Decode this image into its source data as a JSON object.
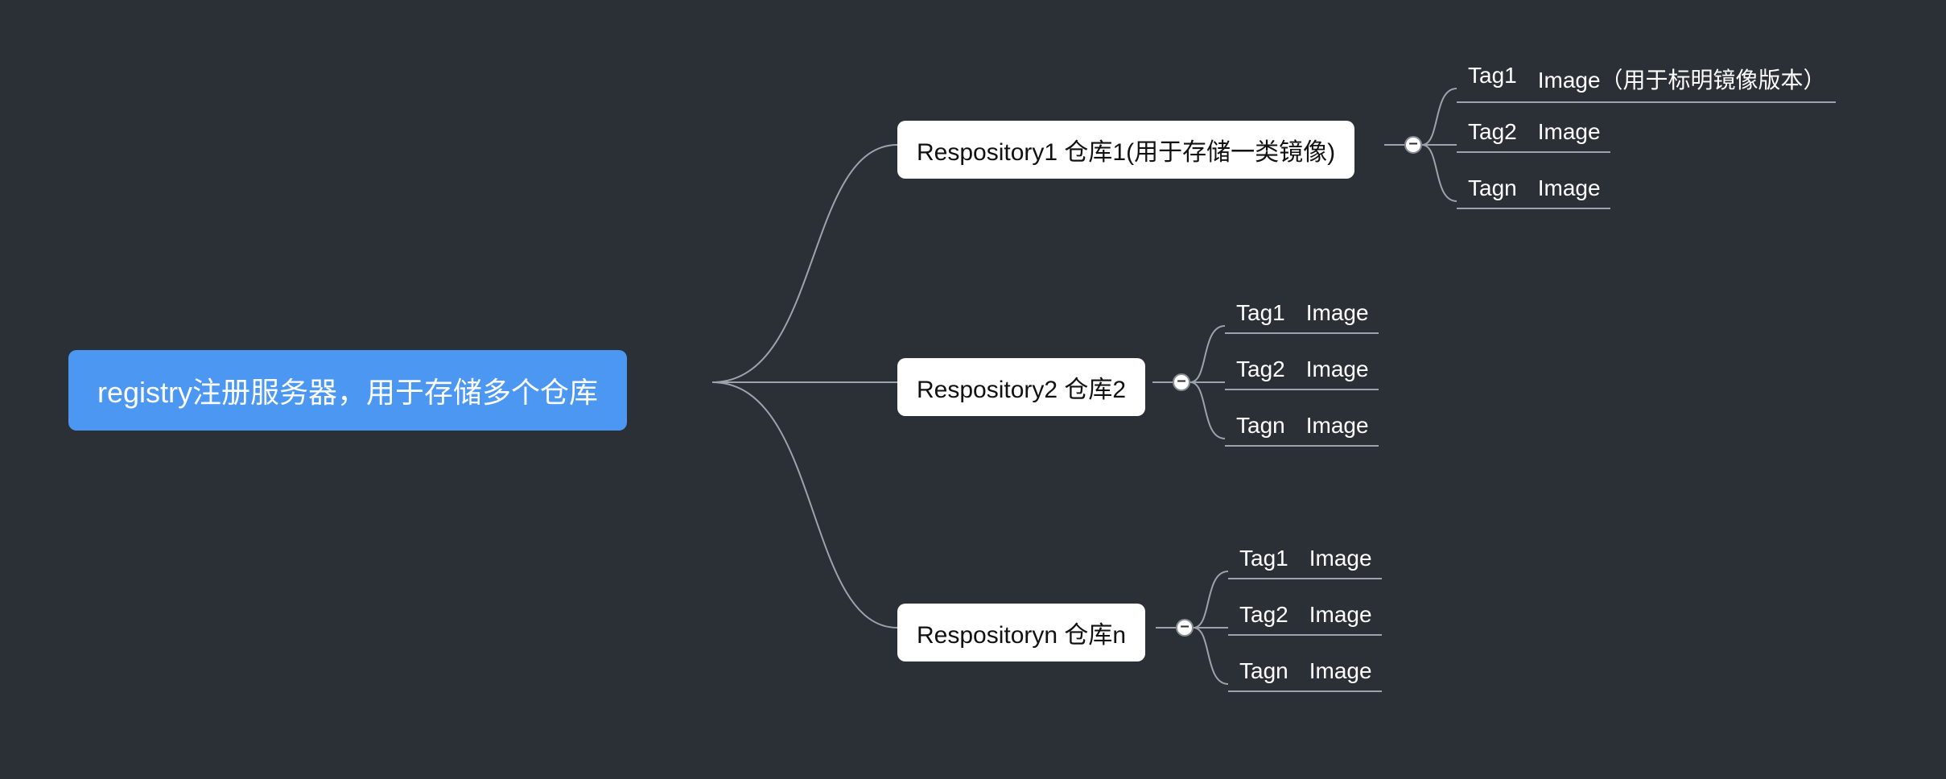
{
  "root": {
    "label": "registry注册服务器，用于存储多个仓库"
  },
  "repositories": [
    {
      "label": "Respository1 仓库1(用于存储一类镜像)",
      "tags": [
        {
          "tag": "Tag1",
          "image": "Image（用于标明镜像版本）"
        },
        {
          "tag": "Tag2",
          "image": "Image"
        },
        {
          "tag": "Tagn",
          "image": "Image"
        }
      ]
    },
    {
      "label": "Respository2 仓库2",
      "tags": [
        {
          "tag": "Tag1",
          "image": "Image"
        },
        {
          "tag": "Tag2",
          "image": "Image"
        },
        {
          "tag": "Tagn",
          "image": "Image"
        }
      ]
    },
    {
      "label": "Respositoryn 仓库n",
      "tags": [
        {
          "tag": "Tag1",
          "image": "Image"
        },
        {
          "tag": "Tag2",
          "image": "Image"
        },
        {
          "tag": "Tagn",
          "image": "Image"
        }
      ]
    }
  ],
  "toggle_symbol": "–",
  "colors": {
    "background": "#2b2f36",
    "root_bg": "#4b97f2",
    "node_bg": "#ffffff",
    "line": "#9ea3ab",
    "text_light": "#ffffff",
    "text_dark": "#111111"
  }
}
